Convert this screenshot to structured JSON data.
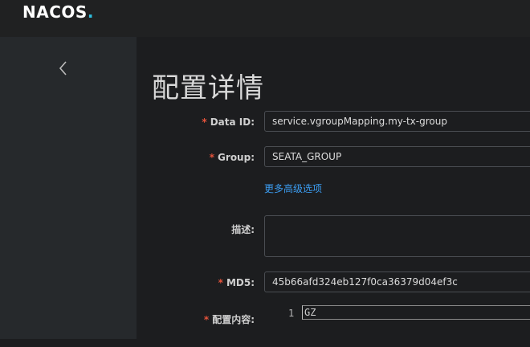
{
  "app": {
    "logo_text": "NACOS",
    "logo_dot": "."
  },
  "sidebar": {
    "collapse_icon": "chevron-left-icon"
  },
  "page": {
    "title": "配置详情"
  },
  "form": {
    "required_mark": "*",
    "data_id": {
      "label": "Data ID:",
      "value": "service.vgroupMapping.my-tx-group"
    },
    "group": {
      "label": "Group:",
      "value": "SEATA_GROUP"
    },
    "advanced_link": "更多高级选项",
    "description": {
      "label": "描述:",
      "value": ""
    },
    "md5": {
      "label": "MD5:",
      "value": "45b66afd324eb127f0ca36379d04ef3c"
    },
    "content": {
      "label": "配置内容:",
      "line_number": "1",
      "line_text": "GZ"
    }
  },
  "colors": {
    "accent": "#3b9cf0",
    "required": "#e5533b",
    "logo_dot": "#2fc0e0"
  }
}
